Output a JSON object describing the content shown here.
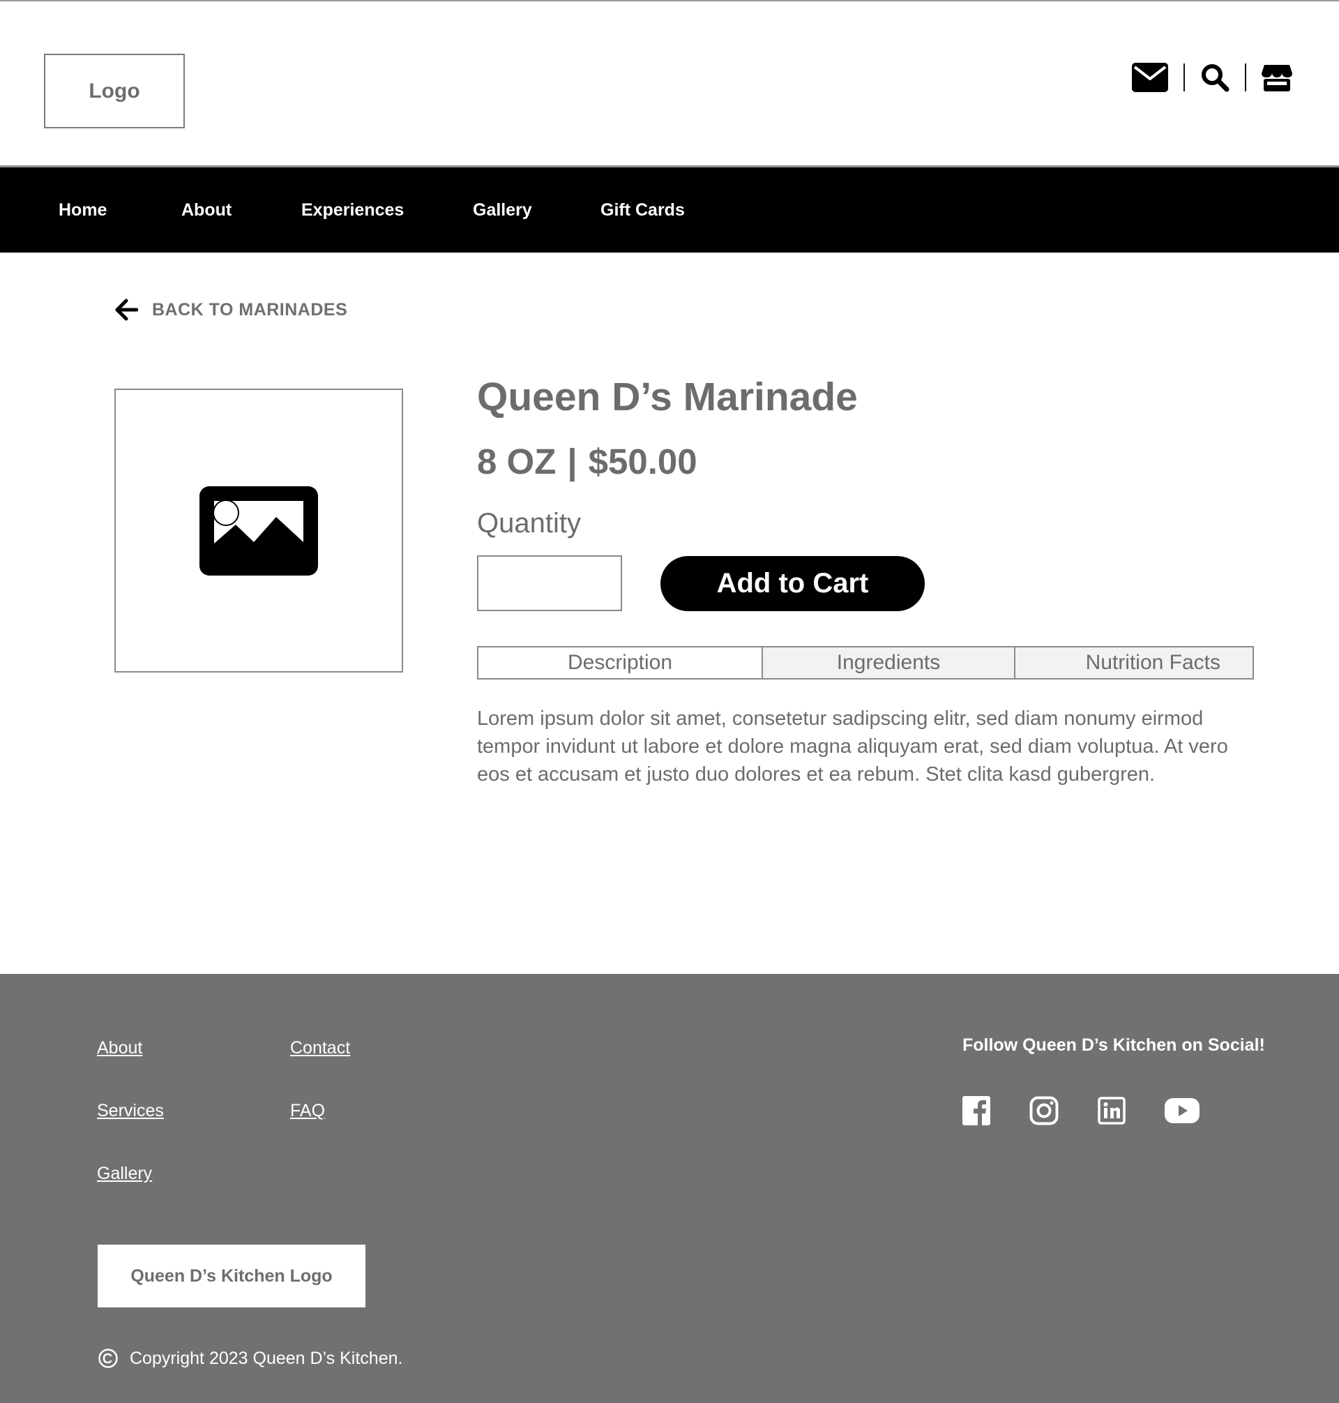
{
  "header": {
    "logo_text": "Logo",
    "icons": [
      "mail-icon",
      "search-icon",
      "store-icon"
    ]
  },
  "nav": {
    "items": [
      {
        "label": "Home"
      },
      {
        "label": "About"
      },
      {
        "label": "Experiences"
      },
      {
        "label": "Gallery"
      },
      {
        "label": "Gift Cards"
      }
    ]
  },
  "back_link": {
    "label": "BACK TO MARINADES",
    "icon": "arrow-left-icon"
  },
  "product": {
    "image_icon": "image-placeholder-icon",
    "title": "Queen D’s Marinade",
    "size": "8 OZ",
    "separator": "|",
    "price": "$50.00",
    "quantity_label": "Quantity",
    "quantity_value": "",
    "add_to_cart_label": "Add to Cart",
    "tabs": [
      {
        "label": "Description",
        "active": true
      },
      {
        "label": "Ingredients",
        "active": false
      },
      {
        "label": "Nutrition Facts",
        "active": false
      }
    ],
    "description": "Lorem ipsum dolor sit amet, consetetur sadipscing elitr, sed diam nonumy eirmod tempor invidunt ut labore et dolore magna aliquyam erat, sed diam voluptua. At vero eos et accusam et justo duo dolores et ea rebum. Stet clita kasd gubergren."
  },
  "footer": {
    "links": [
      {
        "label": "About"
      },
      {
        "label": "Contact"
      },
      {
        "label": "Services"
      },
      {
        "label": "FAQ"
      },
      {
        "label": "Gallery"
      }
    ],
    "social_title": "Follow Queen D’s Kitchen on Social!",
    "social_icons": [
      "facebook-icon",
      "instagram-icon",
      "linkedin-icon",
      "youtube-icon"
    ],
    "logo_text": "Queen D’s Kitchen Logo",
    "copyright": "Copyright 2023 Queen D’s Kitchen."
  },
  "colors": {
    "nav_bg": "#000000",
    "footer_bg": "#717171",
    "text_gray": "#6c6c6c",
    "button_bg": "#000000",
    "inactive_tab_bg": "#f3f2f1"
  }
}
